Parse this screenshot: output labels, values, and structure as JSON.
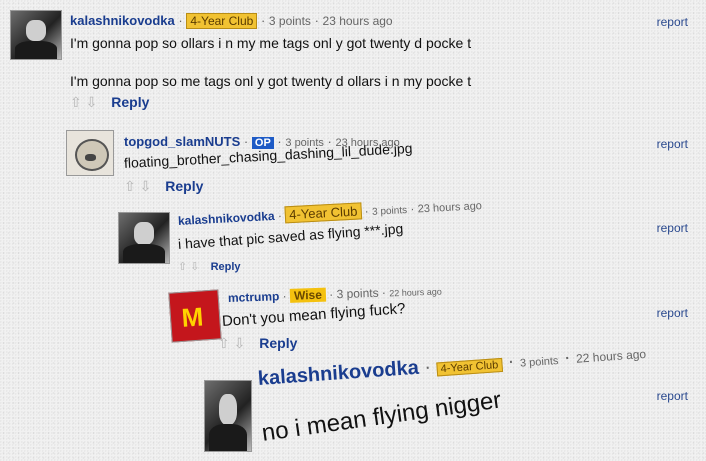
{
  "report_label": "report",
  "reply_label": "Reply",
  "vote_arrows": "⇧ ⇩",
  "comments": [
    {
      "username": "kalashnikovodka",
      "flair": "4-Year Club",
      "points": "3 points",
      "time": "23 hours ago",
      "body_lines": [
        "I'm gonna pop so ollars i n my me tags onl y got twenty d pocke t",
        "I'm gonna pop so me tags onl y got twenty d ollars i n my pocke t"
      ]
    },
    {
      "username": "topgod_slamNUTS",
      "badge": "OP",
      "points": "3 points",
      "time": "23 hours ago",
      "body_lines": [
        "floating_brother_chasing_dashing_lil_dude.jpg"
      ]
    },
    {
      "username": "kalashnikovodka",
      "flair": "4-Year Club",
      "points": "3 points",
      "time": "23 hours ago",
      "body_lines": [
        "i have that pic saved as flying ***.jpg"
      ]
    },
    {
      "username": "mctrump",
      "flair": "Wise",
      "points": "3 points",
      "time": "22 hours ago",
      "body_lines": [
        "Don't you mean flying fuck?"
      ]
    },
    {
      "username": "kalashnikovodka",
      "flair": "4-Year Club",
      "points": "3 points",
      "time": "22 hours ago",
      "body_lines": [
        "no i mean flying nigger"
      ]
    }
  ]
}
